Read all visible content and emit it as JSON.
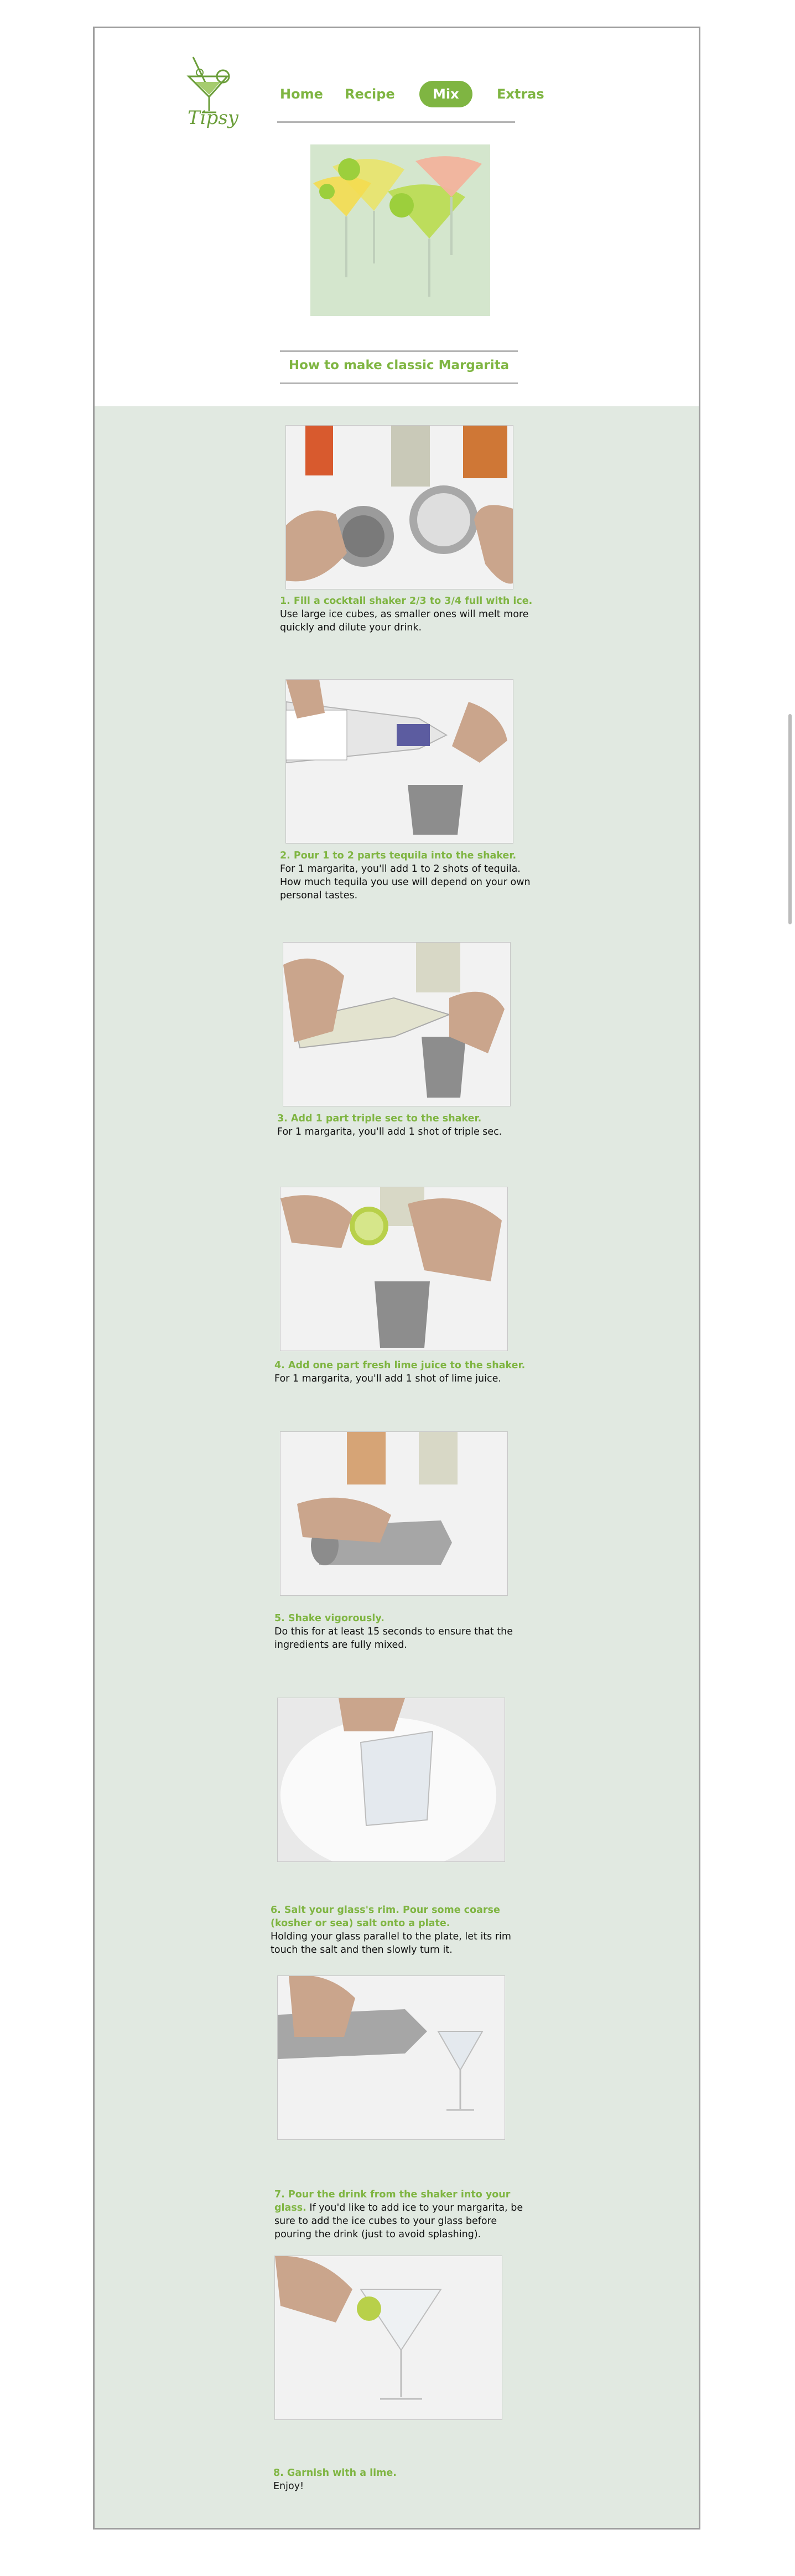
{
  "brand": {
    "name": "Tipsy",
    "logo_icon": "martini-glass-icon",
    "accent": "#7fb542",
    "bg_band": "#e1e9e1"
  },
  "nav": {
    "items": [
      {
        "label": "Home"
      },
      {
        "label": "Recipe"
      },
      {
        "label": "Mix",
        "active": true
      },
      {
        "label": "Extras"
      }
    ]
  },
  "hero": {
    "image": "margarita-glasses-photo"
  },
  "page": {
    "title": "How to make classic Margarita"
  },
  "steps": [
    {
      "title": "1. Fill a cocktail shaker 2/3 to 3/4 full with ice.",
      "body": "Use large ice cubes, as smaller ones will melt more quickly and dilute your drink.",
      "image": "shaker-with-ice-photo"
    },
    {
      "title": "2. Pour 1 to 2 parts tequila into the shaker.",
      "body": "For 1 margarita, you'll add 1 to 2 shots of tequila. How much tequila you use will depend on your own personal tastes.",
      "image": "pouring-tequila-photo"
    },
    {
      "title": "3. Add 1 part triple sec to the shaker.",
      "body": "For 1 margarita, you'll add 1 shot of triple sec.",
      "image": "pouring-triple-sec-photo"
    },
    {
      "title": "4. Add one part fresh lime juice to the shaker.",
      "body": "For 1 margarita, you'll add 1 shot of lime juice.",
      "image": "squeezing-lime-photo"
    },
    {
      "title": "5. Shake vigorously.",
      "body": "Do this for at least 15 seconds to ensure that the ingredients are fully mixed.",
      "image": "shaking-photo"
    },
    {
      "title": "6. Salt your glass's rim. Pour some coarse (kosher or sea) salt onto a plate.",
      "body": "Holding your glass parallel to the plate, let its rim touch the salt and then slowly turn it.",
      "image": "salting-rim-photo"
    },
    {
      "title": "7. Pour the drink from the shaker into your glass.",
      "body": "If you'd like to add ice to your margarita, be sure to add the ice cubes to your glass before pouring the drink (just to avoid splashing).",
      "image": "pouring-drink-photo"
    },
    {
      "title": "8. Garnish with a lime.",
      "body": "Enjoy!",
      "image": "garnish-lime-photo"
    }
  ]
}
